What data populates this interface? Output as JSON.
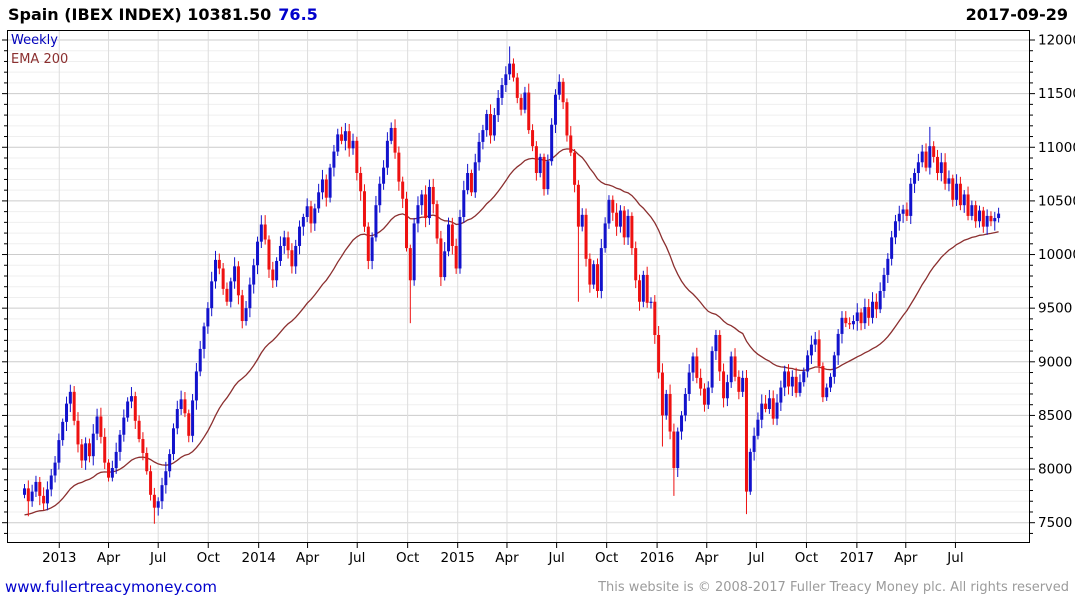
{
  "header": {
    "title": "Spain (IBEX INDEX) 10381.50",
    "change": "76.5",
    "date": "2017-09-29"
  },
  "legend": {
    "series": "Weekly",
    "ema": "EMA 200"
  },
  "footer": {
    "link": "www.fullertreacymoney.com",
    "copyright": "This website is © 2008-2017 Fuller Treacy Money plc. All rights reserved"
  },
  "colors": {
    "up_candle": "#1212cc",
    "down_candle": "#ee1111",
    "ema_line": "#8b2f2f",
    "grid_major": "#cccccc",
    "grid_minor": "#efefef",
    "grid_vertical": "#dddddd",
    "frame": "#000000",
    "accent_blue": "#0000cc",
    "copyright_gray": "#9b9b9b"
  },
  "chart_data": {
    "type": "candlestick",
    "title": "Spain (IBEX INDEX)",
    "interval": "Weekly",
    "overlay": "EMA 200",
    "last_close": 10381.5,
    "change": 76.5,
    "as_of": "2017-09-29",
    "ylim": [
      7300,
      12095
    ],
    "y_ticks": [
      7500,
      8000,
      8500,
      9000,
      9500,
      10000,
      10500,
      11000,
      11500,
      12000
    ],
    "y_minor_step": 100,
    "x_ticks": [
      {
        "label": "2013",
        "week": 9.1
      },
      {
        "label": "Apr",
        "week": 22.0
      },
      {
        "label": "Jul",
        "week": 35.0
      },
      {
        "label": "Oct",
        "week": 48.1
      },
      {
        "label": "2014",
        "week": 61.3
      },
      {
        "label": "Apr",
        "week": 74.1
      },
      {
        "label": "Jul",
        "week": 87.1
      },
      {
        "label": "Oct",
        "week": 100.3
      },
      {
        "label": "2015",
        "week": 113.4
      },
      {
        "label": "Apr",
        "week": 126.3
      },
      {
        "label": "Jul",
        "week": 139.3
      },
      {
        "label": "Oct",
        "week": 152.4
      },
      {
        "label": "2016",
        "week": 165.6
      },
      {
        "label": "Apr",
        "week": 178.6
      },
      {
        "label": "Jul",
        "week": 191.6
      },
      {
        "label": "Oct",
        "week": 204.7
      },
      {
        "label": "2017",
        "week": 217.9
      },
      {
        "label": "Apr",
        "week": 230.7
      },
      {
        "label": "Jul",
        "week": 243.7
      }
    ],
    "weekly_closes": [
      7820,
      7700,
      7790,
      7880,
      7750,
      7680,
      7810,
      7940,
      8060,
      8270,
      8440,
      8610,
      8720,
      8450,
      8230,
      8080,
      8240,
      8120,
      8330,
      8490,
      8300,
      8060,
      7920,
      8010,
      8160,
      8320,
      8480,
      8630,
      8680,
      8450,
      8280,
      8150,
      7980,
      7760,
      7640,
      7700,
      7850,
      7980,
      8140,
      8380,
      8560,
      8650,
      8520,
      8310,
      8640,
      8910,
      9120,
      9330,
      9500,
      9750,
      9950,
      9870,
      9680,
      9560,
      9750,
      9890,
      9620,
      9380,
      9500,
      9720,
      9900,
      10120,
      10280,
      10140,
      9860,
      9760,
      9940,
      10080,
      10160,
      10040,
      9890,
      10080,
      10260,
      10350,
      10450,
      10290,
      10430,
      10580,
      10700,
      10530,
      10810,
      10960,
      11120,
      11060,
      11150,
      10990,
      11060,
      10760,
      10590,
      10260,
      9940,
      10160,
      10460,
      10660,
      10810,
      11060,
      11180,
      10950,
      10680,
      10520,
      10060,
      9760,
      10290,
      10460,
      10560,
      10340,
      10630,
      10470,
      10150,
      9790,
      10030,
      10280,
      10080,
      9870,
      10350,
      10600,
      10760,
      10580,
      10860,
      11050,
      11160,
      11310,
      11110,
      11300,
      11460,
      11580,
      11680,
      11780,
      11650,
      11460,
      11350,
      11510,
      11160,
      11010,
      10760,
      10910,
      10610,
      10870,
      11210,
      11490,
      11610,
      11420,
      11110,
      10950,
      10650,
      10260,
      10370,
      9960,
      9720,
      9910,
      9660,
      10060,
      10290,
      10510,
      10390,
      10260,
      10410,
      10160,
      10360,
      10060,
      9760,
      9560,
      9810,
      9550,
      9560,
      9250,
      8900,
      8500,
      8700,
      8350,
      8010,
      8350,
      8500,
      8700,
      8900,
      9050,
      8850,
      8750,
      8600,
      8760,
      9100,
      9250,
      8910,
      8660,
      8810,
      9050,
      8860,
      8720,
      8850,
      7790,
      8160,
      8310,
      8460,
      8610,
      8560,
      8660,
      8470,
      8620,
      8760,
      8910,
      8770,
      8860,
      8710,
      8810,
      8910,
      9060,
      9160,
      9210,
      8960,
      8670,
      8760,
      8860,
      9060,
      9260,
      9410,
      9360,
      9350,
      9380,
      9460,
      9360,
      9510,
      9410,
      9560,
      9490,
      9660,
      9810,
      9960,
      10160,
      10310,
      10380,
      10420,
      10360,
      10660,
      10760,
      10860,
      10960,
      10810,
      11010,
      10910,
      10760,
      10860,
      10660,
      10710,
      10510,
      10660,
      10460,
      10560,
      10360,
      10460,
      10310,
      10410,
      10260,
      10360,
      10310,
      10340,
      10381.5
    ],
    "first_open": 7760,
    "wick_overrides": {
      "1": {
        "low": 7560
      },
      "34": {
        "low": 7490
      },
      "101": {
        "low": 9360
      },
      "127": {
        "high": 11940
      },
      "140": {
        "high": 11680
      },
      "145": {
        "low": 9560
      },
      "167": {
        "low": 8210
      },
      "170": {
        "low": 7750
      },
      "189": {
        "low": 7580
      },
      "237": {
        "high": 11190
      }
    },
    "ema_period": 40,
    "ema_seed": 7560
  }
}
